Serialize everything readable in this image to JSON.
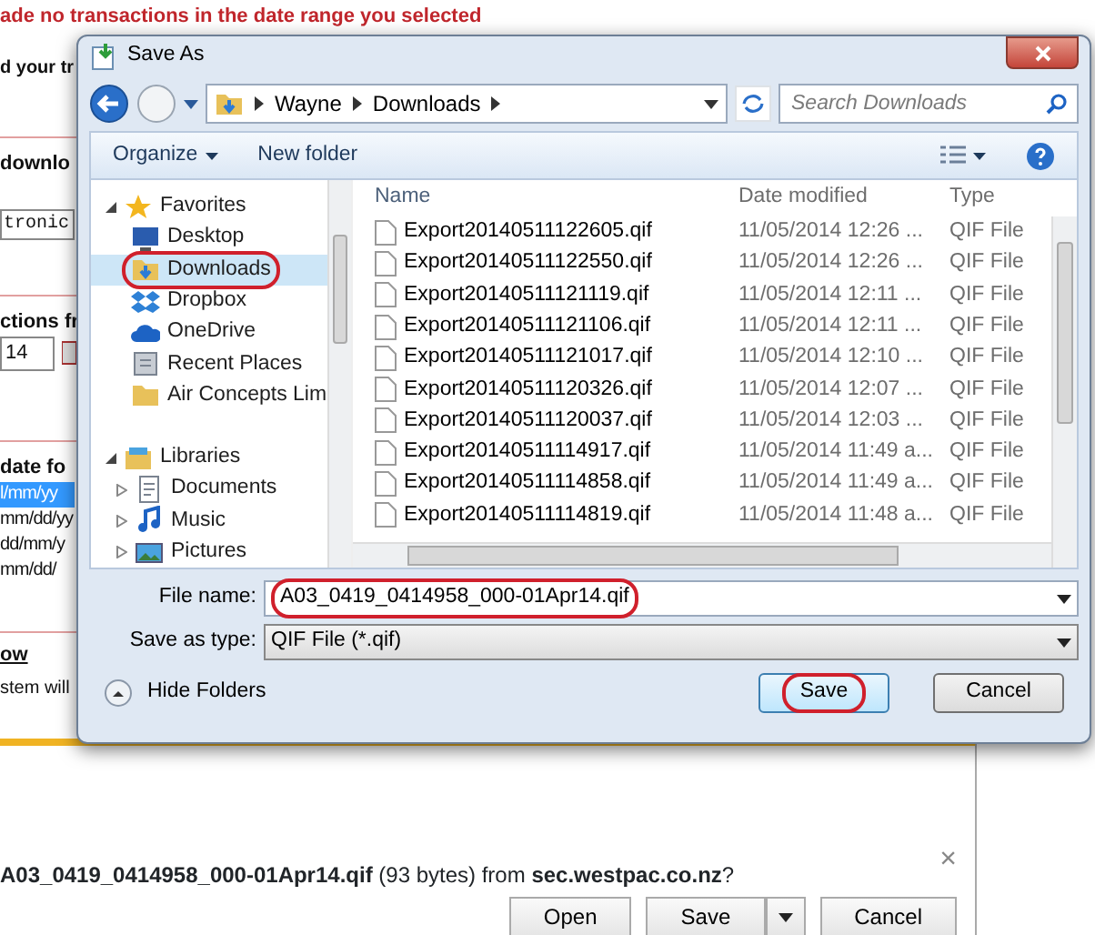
{
  "background_page": {
    "notice": "ade no transactions in the date range you selected",
    "intro": "d your tr",
    "section_1": "downlo",
    "format_field": "tronic",
    "section_2": "ctions fr",
    "year_select": "14",
    "section_3": " date fo",
    "date_formats": [
      {
        "label": "l/mm/yy",
        "selected": true
      },
      {
        "label": "mm/dd/yy",
        "selected": false
      },
      {
        "label": "dd/mm/y",
        "selected": false
      },
      {
        "label": "mm/dd/",
        "selected": false
      }
    ],
    "link": "ow",
    "footer_text": "stem will"
  },
  "dialog": {
    "title": "Save As",
    "breadcrumb": [
      "Wayne",
      "Downloads"
    ],
    "search": {
      "placeholder": "Search Downloads"
    },
    "toolbar": [
      "Organize",
      "New folder"
    ],
    "nav": [
      {
        "label": "Favorites",
        "expanded": true,
        "children": [
          {
            "label": "Desktop",
            "selected": false,
            "circled": false
          },
          {
            "label": "Downloads",
            "selected": true,
            "circled": true
          },
          {
            "label": "Dropbox",
            "selected": false,
            "circled": false
          },
          {
            "label": "OneDrive",
            "selected": false,
            "circled": false
          },
          {
            "label": "Recent Places",
            "selected": false,
            "circled": false
          },
          {
            "label": "Air Concepts Lim",
            "selected": false,
            "circled": false
          }
        ]
      },
      {
        "label": "Libraries",
        "expanded": true,
        "children": [
          {
            "label": "Documents",
            "selected": false,
            "circled": false,
            "expanded": false
          },
          {
            "label": "Music",
            "selected": false,
            "circled": false,
            "expanded": false
          },
          {
            "label": "Pictures",
            "selected": false,
            "circled": false,
            "expanded": false
          }
        ]
      }
    ],
    "columns": [
      "Name",
      "Date modified",
      "Type"
    ],
    "files": [
      {
        "name": "Export20140511122605.qif",
        "date": "11/05/2014 12:26 ...",
        "type": "QIF File"
      },
      {
        "name": "Export20140511122550.qif",
        "date": "11/05/2014 12:26 ...",
        "type": "QIF File"
      },
      {
        "name": "Export20140511121119.qif",
        "date": "11/05/2014 12:11 ...",
        "type": "QIF File"
      },
      {
        "name": "Export20140511121106.qif",
        "date": "11/05/2014 12:11 ...",
        "type": "QIF File"
      },
      {
        "name": "Export20140511121017.qif",
        "date": "11/05/2014 12:10 ...",
        "type": "QIF File"
      },
      {
        "name": "Export20140511120326.qif",
        "date": "11/05/2014 12:07 ...",
        "type": "QIF File"
      },
      {
        "name": "Export20140511120037.qif",
        "date": "11/05/2014 12:03 ...",
        "type": "QIF File"
      },
      {
        "name": "Export20140511114917.qif",
        "date": "11/05/2014 11:49 a...",
        "type": "QIF File"
      },
      {
        "name": "Export20140511114858.qif",
        "date": "11/05/2014 11:49 a...",
        "type": "QIF File"
      },
      {
        "name": "Export20140511114819.qif",
        "date": "11/05/2014 11:48 a...",
        "type": "QIF File"
      }
    ],
    "file_name": {
      "label": "File name:",
      "value": "A03_0419_0414958_000-01Apr14.qif",
      "circled": true
    },
    "save_as_type": {
      "label": "Save as type:",
      "value": "QIF File (*.qif)"
    },
    "hide_folders": "Hide Folders",
    "buttons": [
      {
        "label": "Save",
        "default": true,
        "circled": true
      },
      {
        "label": "Cancel",
        "default": false,
        "circled": false
      }
    ]
  },
  "download_bar": {
    "message": "**A03_0419_0414958_000-01Apr14.qif** (93 bytes) from **sec.westpac.co.nz**?",
    "close": "×",
    "buttons": [
      {
        "label": "Open",
        "kind": "plain"
      },
      {
        "label": "Save",
        "kind": "split"
      },
      {
        "label": "Cancel",
        "kind": "plain"
      }
    ]
  }
}
